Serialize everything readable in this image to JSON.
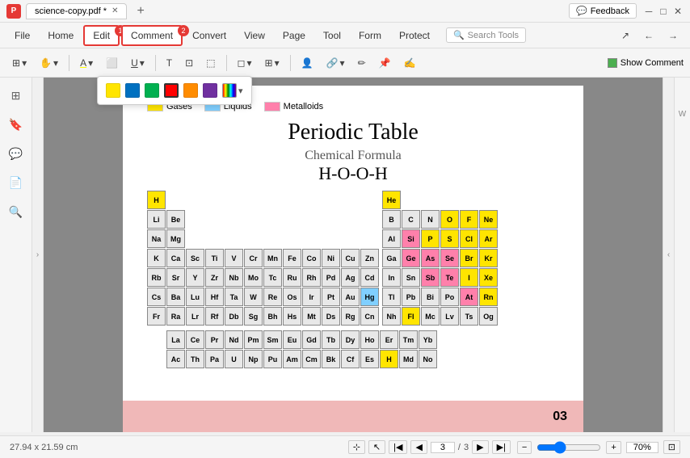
{
  "titleBar": {
    "appIcon": "P",
    "tabName": "science-copy.pdf *",
    "feedbackLabel": "Feedback",
    "windowControls": [
      "─",
      "□",
      "✕"
    ]
  },
  "menuBar": {
    "items": [
      "File",
      "Home",
      "Edit",
      "Comment",
      "Convert",
      "View",
      "Page",
      "Tool",
      "Form",
      "Protect"
    ],
    "editBadge": "1",
    "commentBadge": "2",
    "searchPlaceholder": "Search Tools"
  },
  "toolbar": {
    "showCommentLabel": "Show Comment"
  },
  "colorPicker": {
    "colors": [
      "#FFE500",
      "#0070C0",
      "#00B050",
      "#FF0000",
      "#FF8C00",
      "#7030A0"
    ],
    "selectedIndex": 3
  },
  "pdfContent": {
    "legend": [
      {
        "label": "Gases",
        "color": "#FFE500"
      },
      {
        "label": "Liquids",
        "color": "#80CFFF"
      },
      {
        "label": "Metalloids",
        "color": "#FF80AB"
      }
    ],
    "pageTitle": "Periodic Table",
    "chemicalFormulaLabel": "Chemical Formula",
    "chemicalFormula": "H-O-O-H",
    "pageNumber": "03",
    "pageCount": "3 / 3",
    "dimensions": "27.94 x 21.59 cm"
  },
  "statusBar": {
    "dimensions": "27.94 x 21.59 cm",
    "currentPage": "3",
    "totalPages": "3",
    "zoomLevel": "70%"
  }
}
